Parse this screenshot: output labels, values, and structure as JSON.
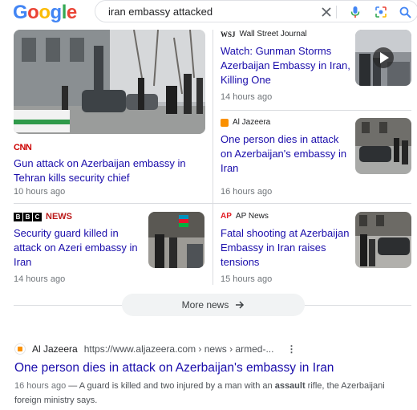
{
  "logo": {
    "letters": [
      "G",
      "o",
      "o",
      "g",
      "l",
      "e"
    ],
    "colors": [
      "#4285F4",
      "#EA4335",
      "#FBBC05",
      "#4285F4",
      "#34A853",
      "#EA4335"
    ]
  },
  "search": {
    "query": "iran embassy attacked"
  },
  "stories": [
    {
      "source": "CNN",
      "headline": "Gun attack on Azerbaijan embassy in Tehran kills security chief",
      "time": "10 hours ago"
    },
    {
      "source": "Wall Street Journal",
      "source_logo": "WSJ",
      "headline": "Watch: Gunman Storms Azerbaijan Embassy in Iran, Killing One",
      "time": "14 hours ago"
    },
    {
      "source": "Al Jazeera",
      "headline": "One person dies in attack on Azerbaijan's embassy in Iran",
      "time": "16 hours ago"
    },
    {
      "source": "BBC NEWS",
      "headline": "Security guard killed in attack on Azeri embassy in Iran",
      "time": "14 hours ago"
    },
    {
      "source": "AP News",
      "source_logo": "AP",
      "headline": "Fatal shooting at Azerbaijan Embassy in Iran raises tensions",
      "time": "15 hours ago"
    }
  ],
  "more_news": {
    "label": "More news"
  },
  "result": {
    "site": "Al Jazeera",
    "url": "https://www.aljazeera.com › news › armed-...",
    "title": "One person dies in attack on Azerbaijan's embassy in Iran",
    "snippet_time": "16 hours ago",
    "snippet_pre": " — A guard is killed and two injured by a man with an ",
    "snippet_bold": "assault",
    "snippet_post": " rifle, the Azerbaijani foreign ministry says."
  },
  "colors": {
    "link": "#1a0dab",
    "meta": "#70757a",
    "cnn": "#cc0000",
    "bbc": "#bb1919",
    "aljazeera": "#fa9000"
  }
}
